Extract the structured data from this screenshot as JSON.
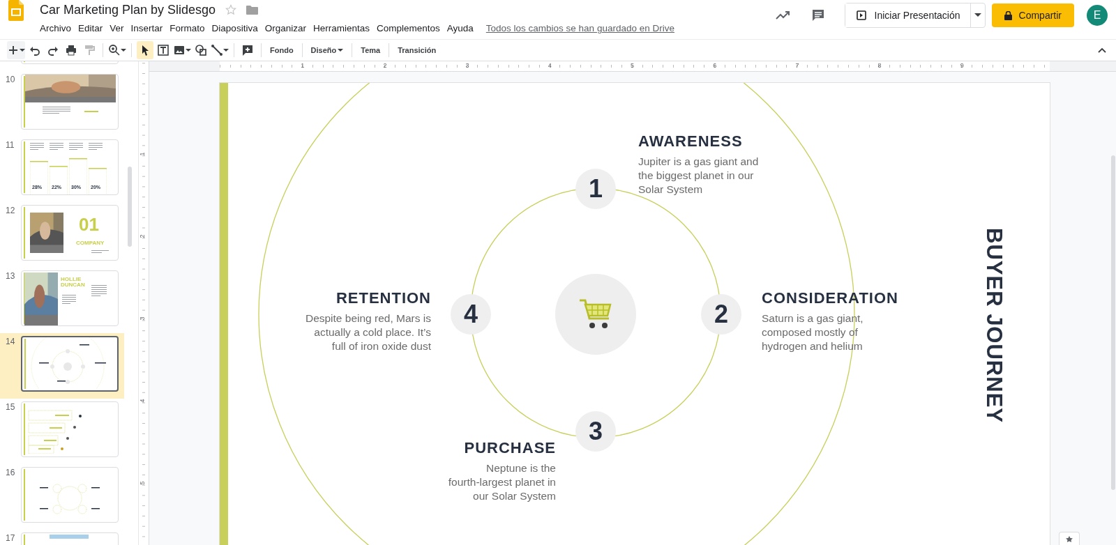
{
  "app": {
    "title": "Car Marketing Plan by Slidesgo",
    "starred": false,
    "menu": [
      "Archivo",
      "Editar",
      "Ver",
      "Insertar",
      "Formato",
      "Diapositiva",
      "Organizar",
      "Herramientas",
      "Complementos",
      "Ayuda"
    ],
    "save_status": "Todos los cambios se han guardado en Drive",
    "present_button": "Iniciar Presentación",
    "share_button": "Compartir",
    "avatar": "E"
  },
  "toolbar": {
    "tools": [
      {
        "selected": true
      },
      {
        "selected": false
      },
      {
        "selected": false
      },
      {
        "selected": false
      },
      {
        "selected": false
      }
    ],
    "text_buttons": [
      {
        "label": "Fondo",
        "kind": "button"
      },
      {
        "label": "Diseño",
        "kind": "dropdown"
      },
      {
        "label": "Tema",
        "kind": "button"
      },
      {
        "label": "Transición",
        "kind": "button"
      }
    ]
  },
  "filmstrip": {
    "slides": [
      {
        "kind": "blank",
        "selected": false
      },
      {
        "number": "10",
        "kind": "photo-quote",
        "selected": false
      },
      {
        "number": "11",
        "kind": "bars",
        "selected": false,
        "texts": [
          "28%",
          "22%",
          "30%",
          "20%"
        ]
      },
      {
        "number": "12",
        "kind": "section",
        "selected": false,
        "texts": [
          "01",
          "COMPANY"
        ]
      },
      {
        "number": "13",
        "kind": "profile",
        "selected": false,
        "texts": [
          "HOLLIE\nDUNCAN"
        ]
      },
      {
        "number": "14",
        "kind": "cycle",
        "selected": true
      },
      {
        "number": "15",
        "kind": "steps",
        "selected": false
      },
      {
        "number": "16",
        "kind": "cycle4",
        "selected": false
      },
      {
        "number": "17",
        "kind": "banner",
        "selected": false
      }
    ]
  },
  "ruler": {
    "horizontal": [
      "1",
      "2",
      "3",
      "4",
      "5",
      "6",
      "7",
      "8",
      "9"
    ],
    "vertical": [
      "1",
      "2",
      "3",
      "4",
      "5"
    ]
  },
  "slide": {
    "side_title": "BUYER JOURNEY",
    "stages": [
      {
        "number": "1",
        "title": "AWARENESS",
        "text": "Jupiter is a gas giant and\nthe biggest planet in our\nSolar System"
      },
      {
        "number": "2",
        "title": "CONSIDERATION",
        "text": "Saturn is a gas giant,\ncomposed mostly of\nhydrogen and helium"
      },
      {
        "number": "3",
        "title": "PURCHASE",
        "text": "Neptune is the\nfourth-largest planet in\nour Solar System"
      },
      {
        "number": "4",
        "title": "RETENTION",
        "text": "Despite being red, Mars is\nactually a cold place. It’s\nfull of iron oxide dust"
      }
    ]
  }
}
